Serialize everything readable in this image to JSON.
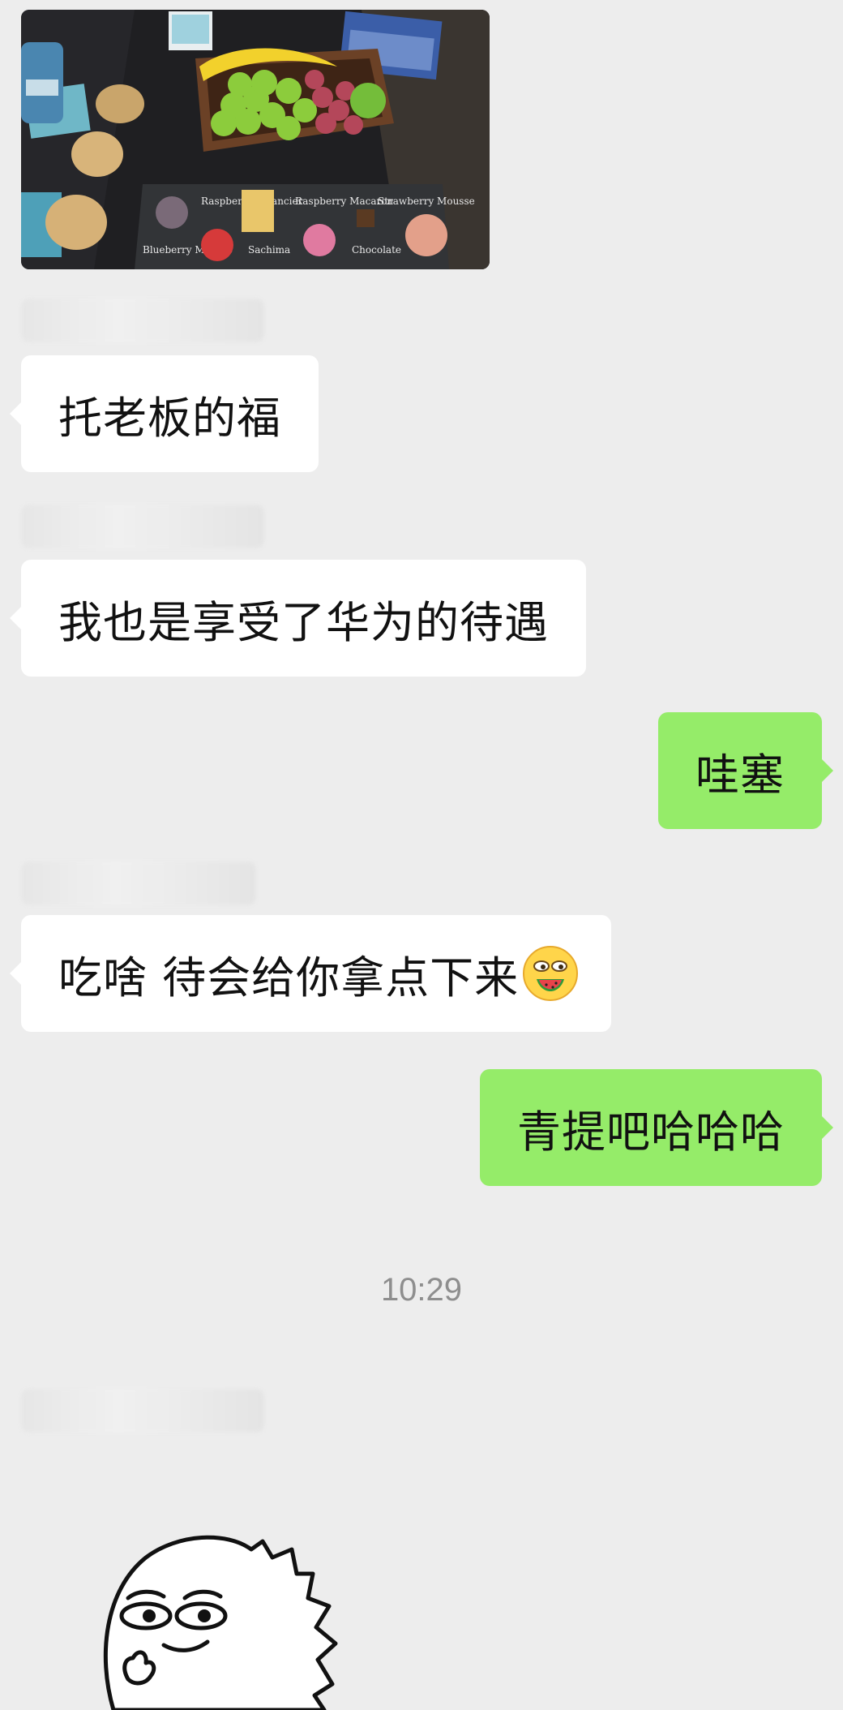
{
  "photo": {
    "dessert_labels": [
      "Raspberry Financier",
      "Raspberry Macaron",
      "Strawberry Mousse",
      "Blueberry Mousse",
      "Sachima",
      "Chocolate"
    ]
  },
  "messages": [
    {
      "from": "other",
      "text": "托老板的福"
    },
    {
      "from": "other",
      "text": "我也是享受了华为的待遇"
    },
    {
      "from": "me",
      "text": "哇塞"
    },
    {
      "from": "other",
      "text": "吃啥 待会给你拿点下来",
      "emoji": "drooling-watermelon-emoji"
    },
    {
      "from": "me",
      "text": "青提吧哈哈哈"
    }
  ],
  "timestamp": "10:29",
  "colors": {
    "background": "#ededed",
    "incoming_bubble": "#ffffff",
    "outgoing_bubble": "#95ec69",
    "timestamp_text": "#8e8e8e"
  }
}
